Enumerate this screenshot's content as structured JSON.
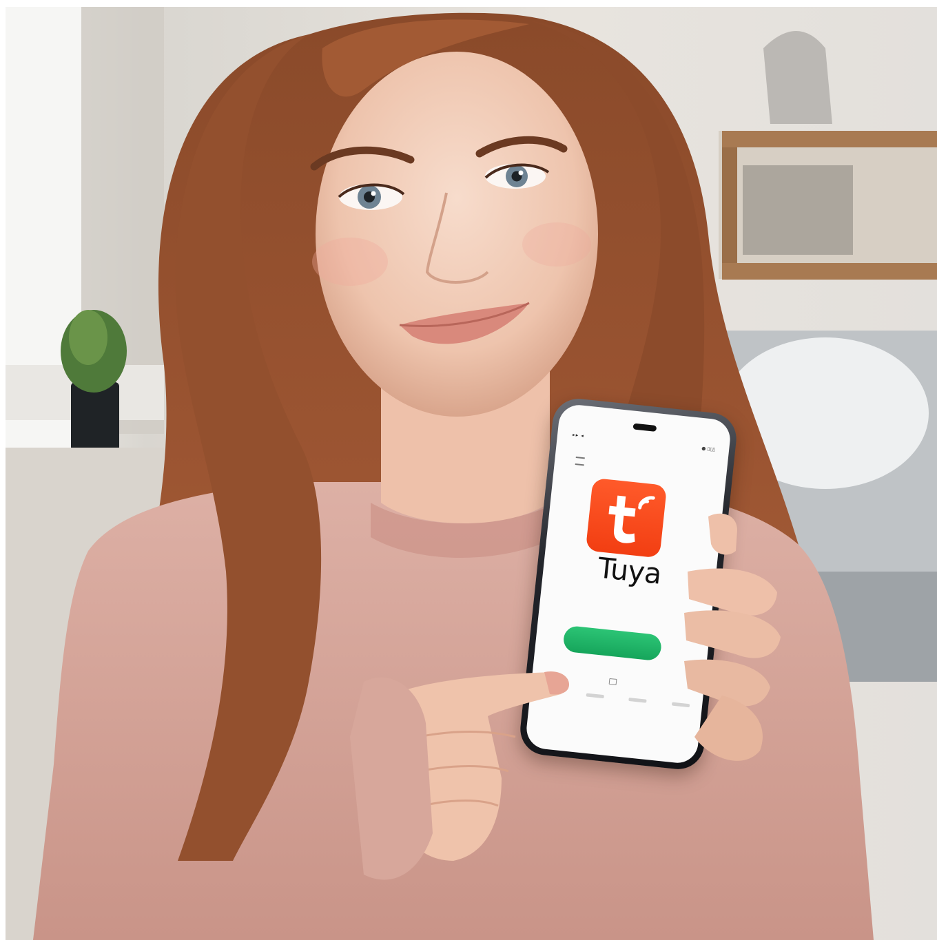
{
  "phone": {
    "status_left": "▸▸ ◂",
    "status_right": "● ▯▯▯",
    "app_name": "Tuya",
    "app_icon_letter": "t"
  },
  "colors": {
    "app_icon": "#f23e12",
    "cta_button": "#16a55b",
    "sweater": "#d8a79d",
    "hair": "#8a4a2a"
  },
  "icons": [
    "menu-icon",
    "wifi-signal-icon",
    "tuya-logo-icon"
  ]
}
